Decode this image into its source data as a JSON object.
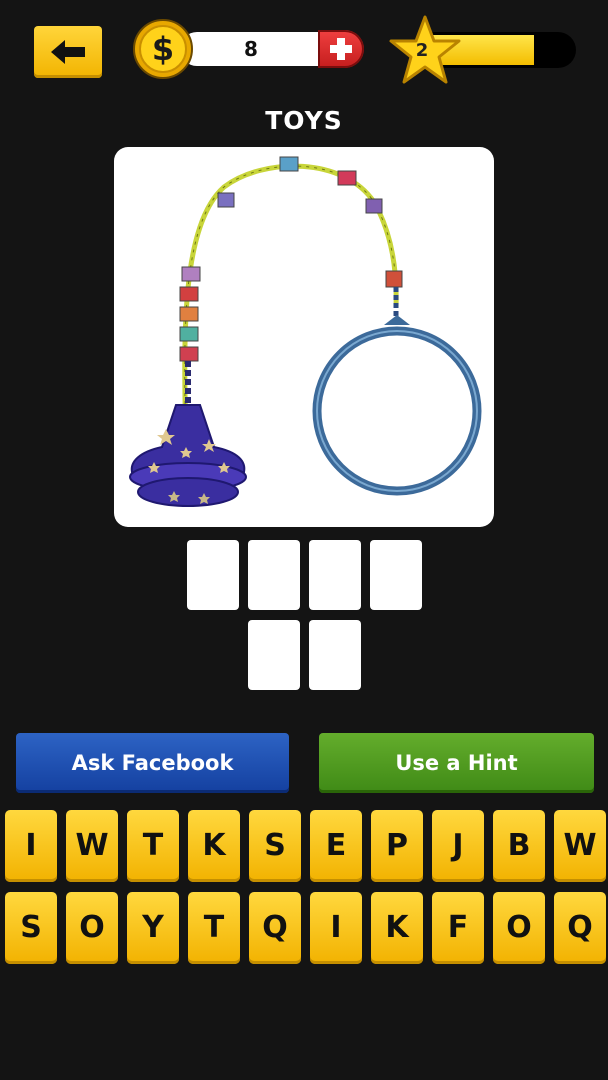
{
  "top_bar": {
    "back_icon": "arrow-left-icon",
    "coins": "8",
    "coin_icon": "dollar-coin-icon",
    "add_coins_icon": "plus-icon",
    "level": "2",
    "level_icon": "star-icon",
    "level_progress_percent": 73
  },
  "puzzle": {
    "category": "TOYS",
    "image_description_icon": "skip-ball-ankle-toy-image",
    "answer_rows": [
      4,
      2
    ]
  },
  "actions": {
    "ask_facebook": "Ask Facebook",
    "use_hint": "Use a Hint"
  },
  "keyboard": {
    "rows": [
      [
        "I",
        "W",
        "T",
        "K",
        "S",
        "E",
        "P",
        "J",
        "B",
        "W"
      ],
      [
        "S",
        "O",
        "Y",
        "T",
        "Q",
        "I",
        "K",
        "F",
        "O",
        "Q"
      ]
    ]
  },
  "colors": {
    "background": "#141414",
    "key_yellow": "#f6c400",
    "facebook_blue": "#1f50b3",
    "hint_green": "#4f9a1f",
    "plus_red": "#d92b2b"
  }
}
